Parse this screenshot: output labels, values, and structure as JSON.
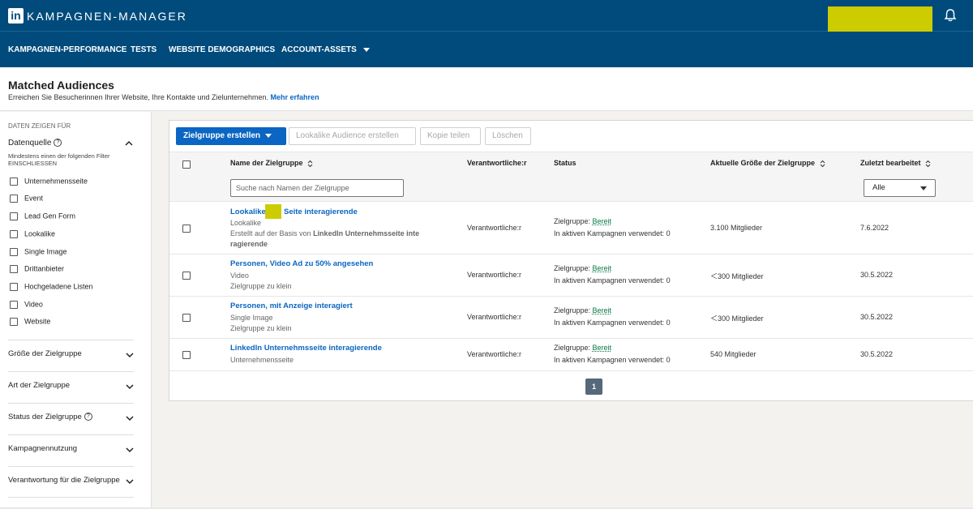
{
  "app": {
    "logo_text": "in",
    "title": "KAMPAGNEN-MANAGER",
    "icons": [
      "linkedin-logo-icon",
      "bell-icon"
    ]
  },
  "nav": {
    "items": [
      {
        "label": "KAMPAGNEN-PERFORMANCE"
      },
      {
        "label": "TESTS"
      },
      {
        "label": "WEBSITE DEMOGRAPHICS"
      },
      {
        "label": "ACCOUNT-ASSETS"
      }
    ]
  },
  "header": {
    "title": "Matched Audiences",
    "subtitle": "Erreichen Sie Besucherinnen Ihrer Website, Ihre Kontakte und Zielunternehmen.",
    "link": "Mehr erfahren"
  },
  "sidebar": {
    "show_data_for": "DATEN ZEIGEN FÜR",
    "source_title": "Datenquelle",
    "hint_line1": "Mindestens einen der folgenden Filter",
    "hint_line2": "EINSCHLIESSEN",
    "filters": [
      "Unternehmensseite",
      "Event",
      "Lead Gen Form",
      "Lookalike",
      "Single Image",
      "Drittanbieter",
      "Hochgeladene Listen",
      "Video",
      "Website"
    ],
    "sections": [
      {
        "label": "Größe der Zielgruppe"
      },
      {
        "label": "Art der Zielgruppe"
      },
      {
        "label": "Status der Zielgruppe"
      },
      {
        "label": "Kampagnennutzung"
      },
      {
        "label": "Verantwortung für die Zielgruppe"
      }
    ]
  },
  "toolbar": {
    "create": "Zielgruppe erstellen",
    "lookalike": "Lookalike Audience erstellen",
    "share": "Kopie teilen",
    "delete": "Löschen"
  },
  "table": {
    "headers": {
      "name": "Name der Zielgruppe",
      "owner": "Verantwortliche:r",
      "status": "Status",
      "size": "Aktuelle Größe der Zielgruppe",
      "edited": "Zuletzt bearbeitet"
    },
    "search_placeholder": "Suche nach Namen der Zielgruppe",
    "filter_value": "Alle",
    "status_prefix": "Zielgruppe:",
    "rows": [
      {
        "name_a": "Lookalike",
        "name_b": "Seite interagierende",
        "type": "Lookalike",
        "note": "Erstellt auf der Basis von",
        "note_bold": "LinkedIn Unternehmsseite inte",
        "note_cont": "ragierende",
        "owner": "Verantwortliche:r",
        "status": "Bereit",
        "usage": "In aktiven Kampagnen verwendet: 0",
        "size": "3.100 Mitglieder",
        "edited": "7.6.2022"
      },
      {
        "name": "Personen, Video Ad zu 50% angesehen",
        "type": "Video",
        "note": "Zielgruppe zu klein",
        "owner": "Verantwortliche:r",
        "status": "Bereit",
        "usage": "In aktiven Kampagnen verwendet: 0",
        "size": "＜300 Mitglieder",
        "edited": "30.5.2022"
      },
      {
        "name": "Personen, mit Anzeige interagiert",
        "type": "Single Image",
        "note": "Zielgruppe zu klein",
        "owner": "Verantwortliche:r",
        "status": "Bereit",
        "usage": "In aktiven Kampagnen verwendet: 0",
        "size": "＜300 Mitglieder",
        "edited": "30.5.2022"
      },
      {
        "name": "LinkedIn Unternehmsseite interagierende",
        "type": "Unternehmensseite",
        "owner": "Verantwortliche:r",
        "status": "Bereit",
        "usage": "In aktiven Kampagnen verwendet: 0",
        "size": "540 Mitglieder",
        "edited": "30.5.2022"
      }
    ]
  },
  "pagination": {
    "current": "1"
  },
  "colors": {
    "brand": "#004b7c",
    "accent": "#0a66c2",
    "ready": "#057642",
    "redaction": "#cccc00"
  }
}
